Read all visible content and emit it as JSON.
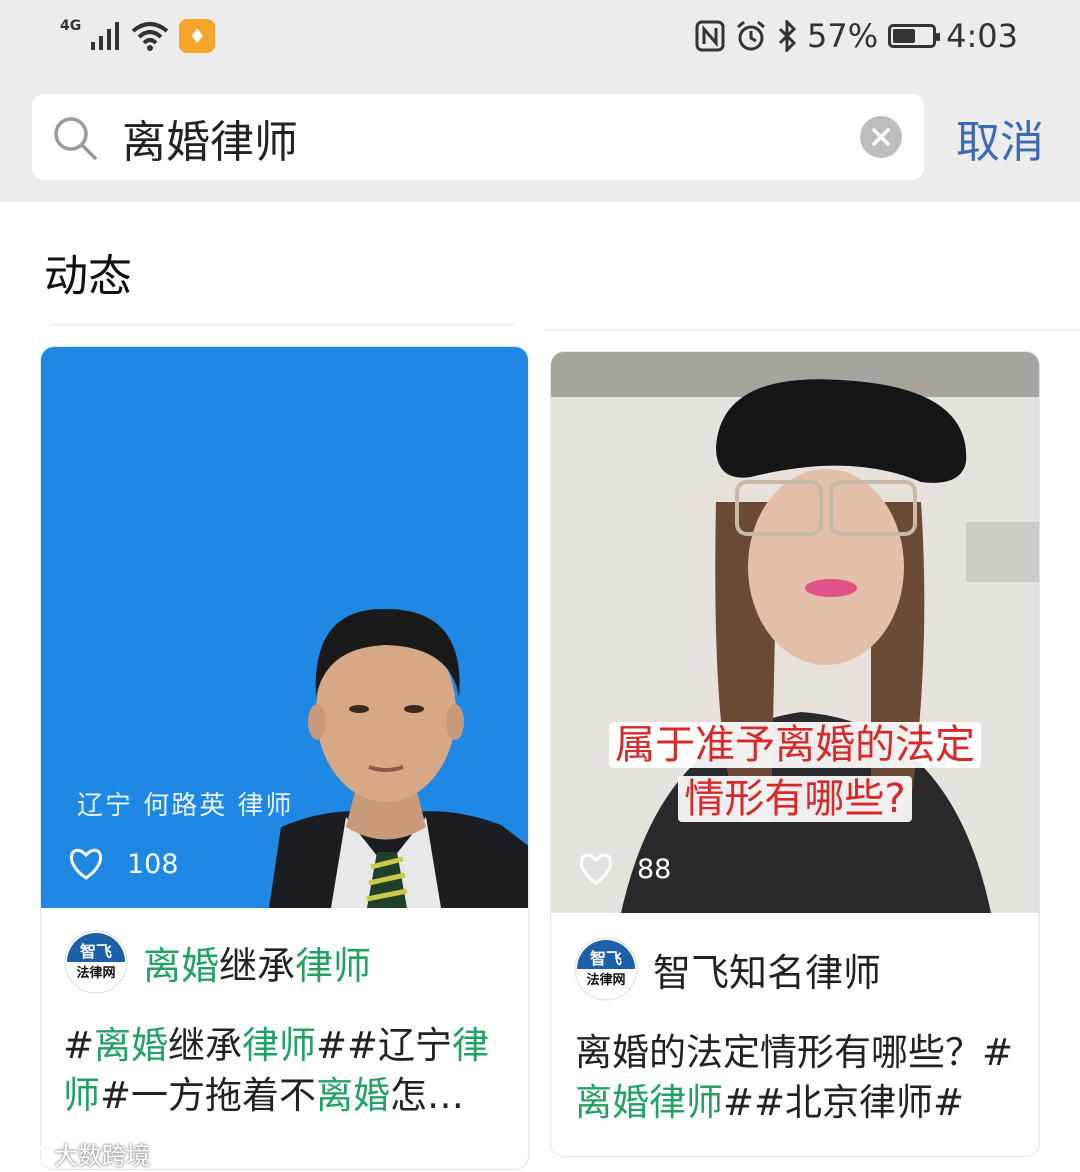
{
  "status_bar": {
    "network": "4G",
    "battery_text": "57%",
    "battery_level": 0.57,
    "time": "4:03"
  },
  "search": {
    "query": "离婚律师",
    "cancel_label": "取消"
  },
  "section": {
    "title": "动态"
  },
  "cards": [
    {
      "overlay_text": "辽宁  何路英  律师",
      "likes": "108",
      "avatar_top": "智飞",
      "avatar_bottom": "法律网",
      "author_parts": [
        "离婚",
        "继承",
        "律师"
      ],
      "text_parts": [
        "#",
        "离婚",
        "继承",
        "律师",
        "##辽宁",
        "律师",
        "#一方拖着不",
        "离婚",
        "怎…"
      ]
    },
    {
      "caption_line1": "属于准予离婚的法定",
      "caption_line2": "情形有哪些?",
      "likes": "88",
      "avatar_top": "智飞",
      "avatar_bottom": "法律网",
      "author": "智飞知名律师",
      "text_parts": [
        "离婚的法定情形有哪些？#",
        "离婚律师",
        "##北京律师#"
      ]
    }
  ],
  "watermark": "大数跨境",
  "colors": {
    "highlight": "#21a263",
    "cancel": "#3d6bb3",
    "card1_thumb": "#1f88e5",
    "header_bg": "#ececec"
  }
}
